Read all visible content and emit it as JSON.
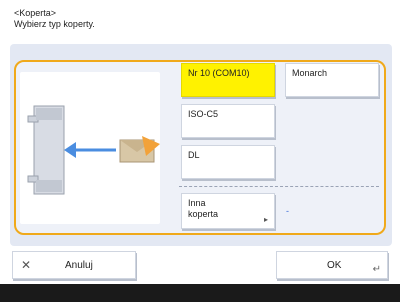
{
  "header": {
    "title": "<Koperta>",
    "subtitle": "Wybierz typ koperty."
  },
  "options": {
    "com10": "Nr 10 (COM10)",
    "monarch": "Monarch",
    "iso": "ISO-C5",
    "dl": "DL",
    "other_line1": "Inna",
    "other_line2": "koperta",
    "other_value": "-"
  },
  "icons": {
    "other_chevron": "chevron-right-small",
    "ok_corner": "enter-arrow"
  },
  "bottom": {
    "cancel_label": "Anuluj",
    "ok_label": "OK"
  },
  "colors": {
    "selected": "#fff200",
    "frame": "#f0a91a",
    "panel": "#e3e8f3",
    "arrow": "#4a8de0"
  }
}
